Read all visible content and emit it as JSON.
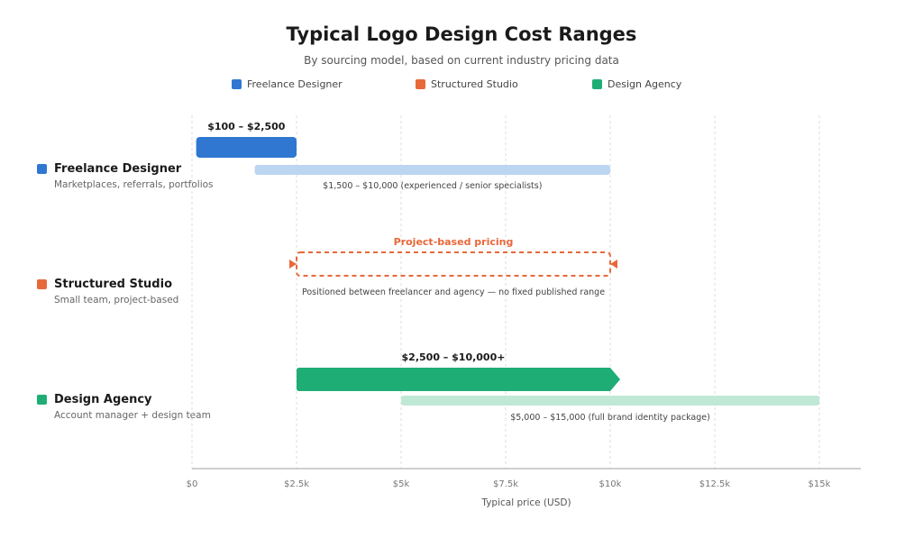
{
  "title": "Typical Logo Design Cost Ranges",
  "subtitle": "By sourcing model, based on current industry pricing data",
  "legend": [
    {
      "label": "Freelance Designer",
      "color": "#2f77d1"
    },
    {
      "label": "Structured Studio",
      "color": "#e8683a"
    },
    {
      "label": "Design Agency",
      "color": "#1fad76"
    }
  ],
  "rows": [
    {
      "name": "Freelance Designer",
      "sub": "Marketplaces, referrals, portfolios",
      "color": "#2f77d1"
    },
    {
      "name": "Structured Studio",
      "sub": "Small team, project-based",
      "color": "#e8683a"
    },
    {
      "name": "Design Agency",
      "sub": "Account manager + design team",
      "color": "#1fad76"
    }
  ],
  "chart_data": {
    "type": "bar",
    "orientation": "horizontal-range",
    "xlabel": "Typical price (USD)",
    "xlim": [
      0,
      16000
    ],
    "x_ticks": [
      0,
      2500,
      5000,
      7500,
      10000,
      12500,
      15000
    ],
    "x_tick_labels": [
      "$0",
      "$2.5k",
      "$5k",
      "$7.5k",
      "$10k",
      "$12.5k",
      "$15k"
    ],
    "grid": true,
    "legend_position": "top-center",
    "categories": [
      "Freelance Designer",
      "Structured Studio",
      "Design Agency"
    ],
    "series": [
      {
        "name": "Freelance Designer",
        "category": "Freelance Designer",
        "kind": "primary",
        "start": 100,
        "end": 2500,
        "label": "$100 – $2,500",
        "color": "#2f77d1"
      },
      {
        "name": "Freelance Designer",
        "category": "Freelance Designer",
        "kind": "secondary",
        "start": 1500,
        "end": 10000,
        "label": "$1,500 – $10,000 (experienced / senior specialists)",
        "color": "#bcd5f1"
      },
      {
        "name": "Structured Studio",
        "category": "Structured Studio",
        "kind": "dashed",
        "start": 2500,
        "end": 10000,
        "label": "Project-based pricing",
        "note": "Positioned between freelancer and agency — no fixed published range",
        "color": "#e8683a"
      },
      {
        "name": "Design Agency",
        "category": "Design Agency",
        "kind": "primary-arrow",
        "start": 2500,
        "end": 10000,
        "label": "$2,500 – $10,000+",
        "color": "#1fad76"
      },
      {
        "name": "Design Agency",
        "category": "Design Agency",
        "kind": "secondary",
        "start": 5000,
        "end": 15000,
        "label": "$5,000 – $15,000 (full brand identity package)",
        "color": "#bfe8d5"
      }
    ]
  }
}
